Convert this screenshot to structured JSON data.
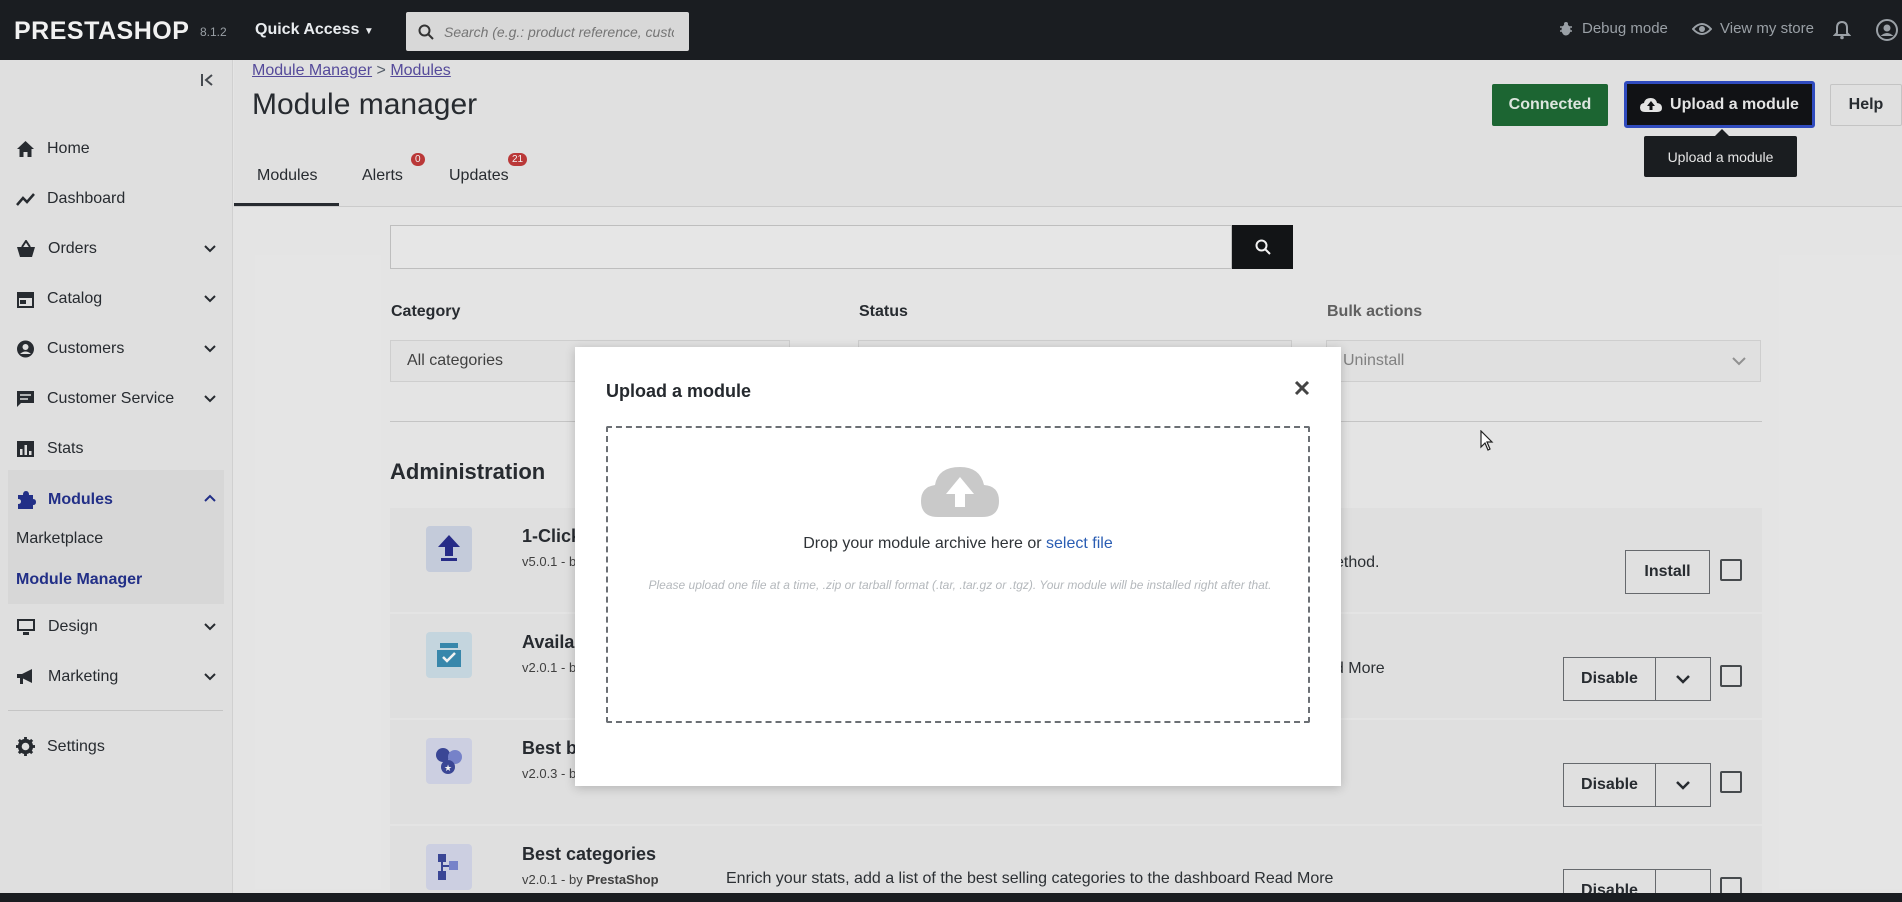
{
  "topbar": {
    "brand": "PRESTASHOP",
    "version": "8.1.2",
    "quick_access": "Quick Access",
    "search_placeholder": "Search (e.g.: product reference, custon",
    "debug_mode": "Debug mode",
    "view_store": "View my store"
  },
  "sidebar": {
    "items": [
      {
        "label": "Home",
        "icon": "home-icon"
      },
      {
        "label": "Dashboard",
        "icon": "trending-icon"
      },
      {
        "label": "Orders",
        "icon": "basket-icon"
      },
      {
        "label": "Catalog",
        "icon": "store-icon"
      },
      {
        "label": "Customers",
        "icon": "account-icon"
      },
      {
        "label": "Customer Service",
        "icon": "chat-icon"
      },
      {
        "label": "Stats",
        "icon": "bar-chart-icon"
      },
      {
        "label": "Modules",
        "icon": "puzzle-icon"
      },
      {
        "label": "Design",
        "icon": "desktop-icon"
      },
      {
        "label": "Marketing",
        "icon": "megaphone-icon"
      },
      {
        "label": "Settings",
        "icon": "gear-icon"
      }
    ],
    "subitems": [
      {
        "label": "Marketplace"
      },
      {
        "label": "Module Manager"
      }
    ]
  },
  "header": {
    "breadcrumb_1": "Module Manager",
    "breadcrumb_sep": ">",
    "breadcrumb_2": "Modules",
    "title": "Module manager",
    "connected_label": "Connected",
    "upload_label": "Upload a module",
    "help_label": "Help",
    "tooltip": "Upload a module"
  },
  "tabs": [
    {
      "label": "Modules"
    },
    {
      "label": "Alerts",
      "badge": "0"
    },
    {
      "label": "Updates",
      "badge": "21"
    }
  ],
  "filters": {
    "category_label": "Category",
    "category_value": "All categories",
    "status_label": "Status",
    "bulk_label": "Bulk actions",
    "bulk_value": "Uninstall"
  },
  "section": {
    "title": "Administration"
  },
  "modules": [
    {
      "name": "1-Click",
      "version": "v5.0.1 - b",
      "desc": "ethod.",
      "action": "Install"
    },
    {
      "name": "Availa",
      "version": "v2.0.1 - b",
      "desc": "ad More",
      "action": "Disable"
    },
    {
      "name": "Best b",
      "version": "v2.0.3 - b",
      "desc": "",
      "action": "Disable"
    },
    {
      "name": "Best categories",
      "version": "v2.0.1 - by ",
      "author": "PrestaShop",
      "desc": "Enrich your stats, add a list of the best selling categories to the dashboard Read More",
      "action": "Disable"
    }
  ],
  "modal": {
    "title": "Upload a module",
    "drop_text": "Drop your module archive here or ",
    "select_file": "select file",
    "hint": "Please upload one file at a time, .zip or tarball format (.tar, .tar.gz or .tgz). Your module will be installed right after that."
  },
  "colors": {
    "accent": "#24328f",
    "connected": "#1e6b35",
    "badge": "#c53b3b",
    "link": "#2a5db3"
  }
}
